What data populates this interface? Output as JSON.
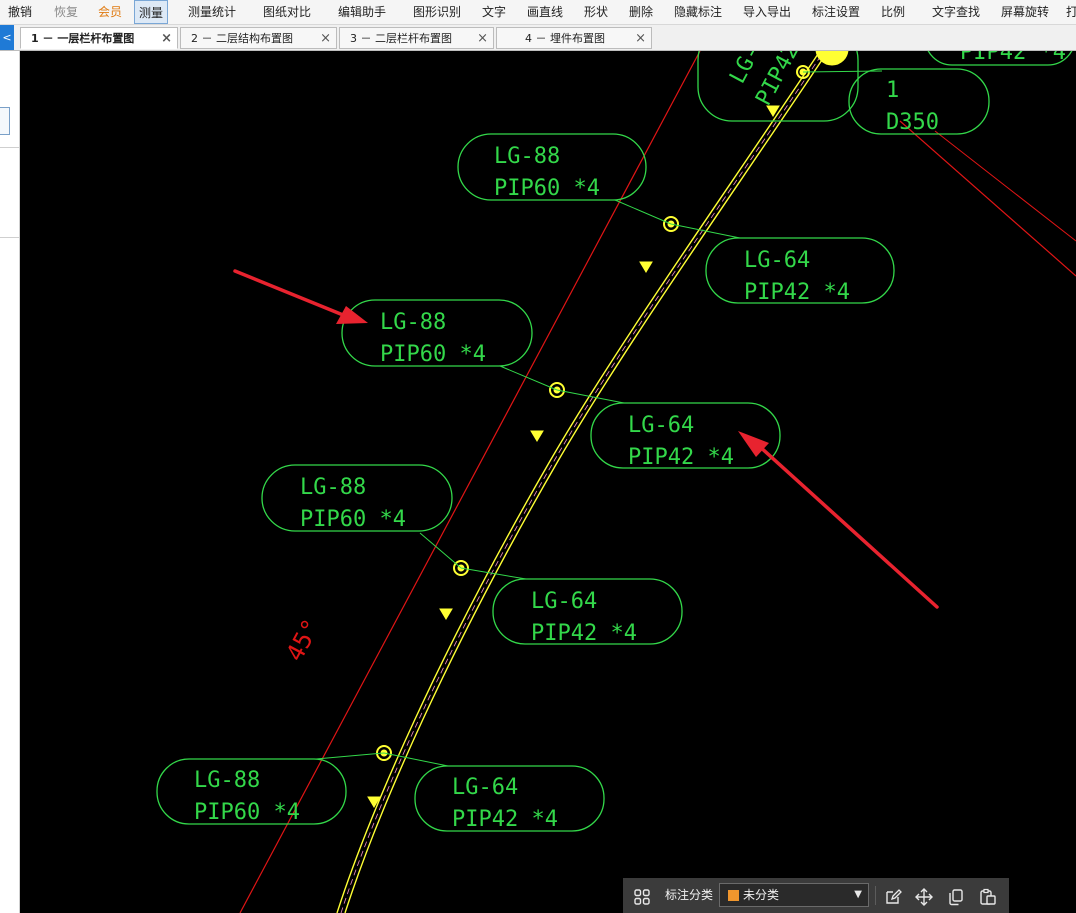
{
  "menubar": {
    "items": [
      {
        "label": "撤销",
        "state": "normal"
      },
      {
        "label": "恢复",
        "state": "disabled"
      },
      {
        "label": "会员",
        "state": "vip"
      },
      {
        "label": "测量",
        "state": "active"
      },
      {
        "label": "测量统计",
        "state": "normal"
      },
      {
        "label": "图纸对比",
        "state": "normal"
      },
      {
        "label": "编辑助手",
        "state": "normal"
      },
      {
        "label": "图形识别",
        "state": "normal"
      },
      {
        "label": "文字",
        "state": "normal"
      },
      {
        "label": "画直线",
        "state": "normal"
      },
      {
        "label": "形状",
        "state": "normal"
      },
      {
        "label": "删除",
        "state": "normal"
      },
      {
        "label": "隐藏标注",
        "state": "normal"
      },
      {
        "label": "导入导出",
        "state": "normal"
      },
      {
        "label": "标注设置",
        "state": "normal"
      },
      {
        "label": "比例",
        "state": "normal"
      },
      {
        "label": "文字查找",
        "state": "normal"
      },
      {
        "label": "屏幕旋转",
        "state": "normal"
      },
      {
        "label": "打",
        "state": "normal"
      }
    ]
  },
  "tabs": [
    {
      "label": "1 － 一层栏杆布置图",
      "active": true
    },
    {
      "label": "2 － 二层结构布置图",
      "active": false
    },
    {
      "label": "3 － 二层栏杆布置图",
      "active": false
    },
    {
      "label": "4 － 埋件布置图",
      "active": false
    }
  ],
  "tab_close_glyph": "×",
  "left_toggle_glyph": "<",
  "drawing": {
    "background_color": "#000000",
    "tag_color": "#33d84a",
    "axis_line_color": "#e01515",
    "railing_color": "#ffff33",
    "arrow_color": "#e8232f",
    "angle_label": "45°",
    "tags": [
      {
        "line1": "LG-88",
        "line2": "PIP60 *4"
      },
      {
        "line1": "LG-64",
        "line2": "PIP42 *4"
      },
      {
        "line1": "LG-88",
        "line2": "PIP60 *4"
      },
      {
        "line1": "LG-64",
        "line2": "PIP42 *4"
      },
      {
        "line1": "LG-88",
        "line2": "PIP60 *4"
      },
      {
        "line1": "LG-64",
        "line2": "PIP42 *4"
      },
      {
        "line1": "LG-88",
        "line2": "PIP60 *4"
      },
      {
        "line1": "LG-64",
        "line2": "PIP42 *4"
      },
      {
        "line1": "1",
        "line2": "D350"
      },
      {
        "line1": "LG-",
        "line2": "PIP42"
      },
      {
        "line1": "",
        "line2": "PIP42 *4"
      }
    ]
  },
  "bottom_toolbar": {
    "category_label": "标注分类",
    "category_value": "未分类",
    "swatch_color": "#f0962d",
    "icons": [
      "grid-icon",
      "edit-note-icon",
      "move-icon",
      "copy-icon",
      "paste-icon"
    ]
  }
}
